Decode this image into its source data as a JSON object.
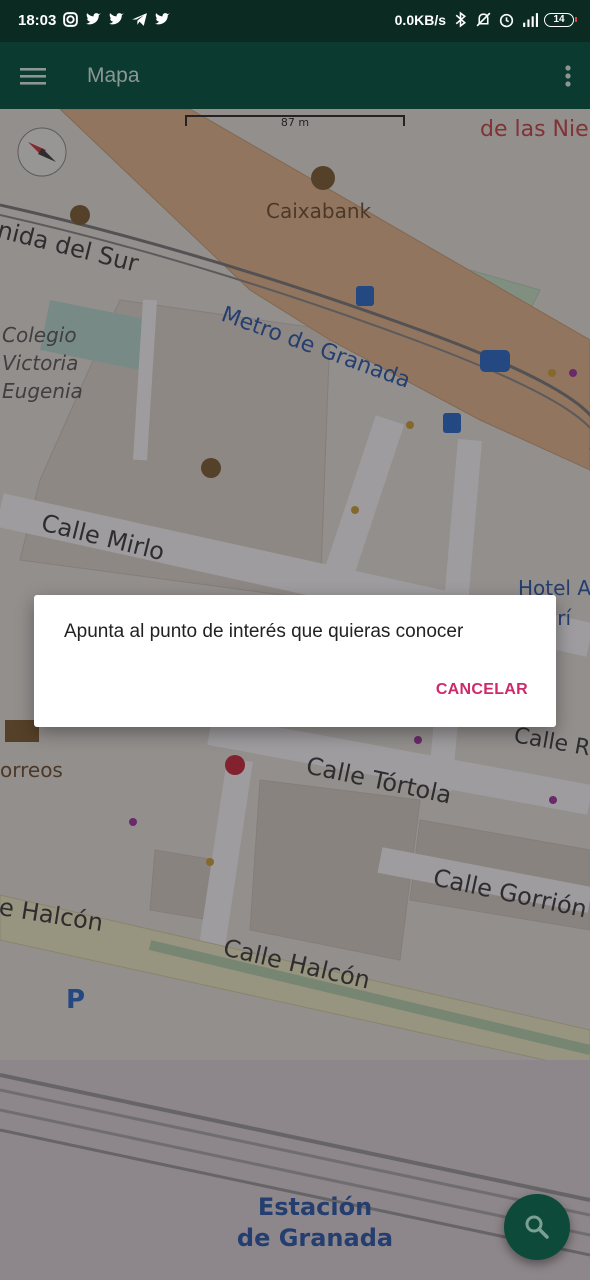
{
  "status_bar": {
    "time": "18:03",
    "notification_icons": [
      "instagram-icon",
      "twitter-icon",
      "twitter-icon",
      "telegram-icon",
      "twitter-icon"
    ],
    "network_speed": "0.0KB/s",
    "battery_level": "14",
    "right_icons": [
      "bluetooth-icon",
      "mute-icon",
      "alarm-icon",
      "signal-icon",
      "battery-icon"
    ]
  },
  "app_bar": {
    "title": "Mapa",
    "menu_icon": "hamburger-menu-icon",
    "overflow_icon": "more-vert-icon"
  },
  "map": {
    "scale_label": "87 m",
    "labels": {
      "top_right_partial": "de las Nie",
      "caixabank": "Caixabank",
      "avenida": "nida del Sur",
      "metro": "Metro de Granada",
      "colegio_1": "Colegio",
      "colegio_2": "Victoria",
      "colegio_3": "Eugenia",
      "calle_mirlo": "Calle Mirlo",
      "hotel_1": "Hotel A",
      "hotel_2": "arí",
      "correos": "orreos",
      "calle_r": "Calle R",
      "calle_tortola": "Calle Tórtola",
      "calle_gorrion": "Calle Gorrión",
      "halcon_partial": "e Halcón",
      "calle_halcon": "Calle Halcón",
      "parking": "P",
      "estacion_1": "Estación",
      "estacion_2": "de Granada"
    },
    "colors": {
      "road_main": "#e8b98a",
      "transit": "#2255aa",
      "poi": "#7a5a2a",
      "water": "#a9d3df"
    }
  },
  "dialog": {
    "message": "Apunta al punto de interés que quieras conocer",
    "cancel_label": "CANCELAR",
    "accent_color": "#cc2a6b"
  },
  "fab": {
    "icon": "search-icon"
  }
}
